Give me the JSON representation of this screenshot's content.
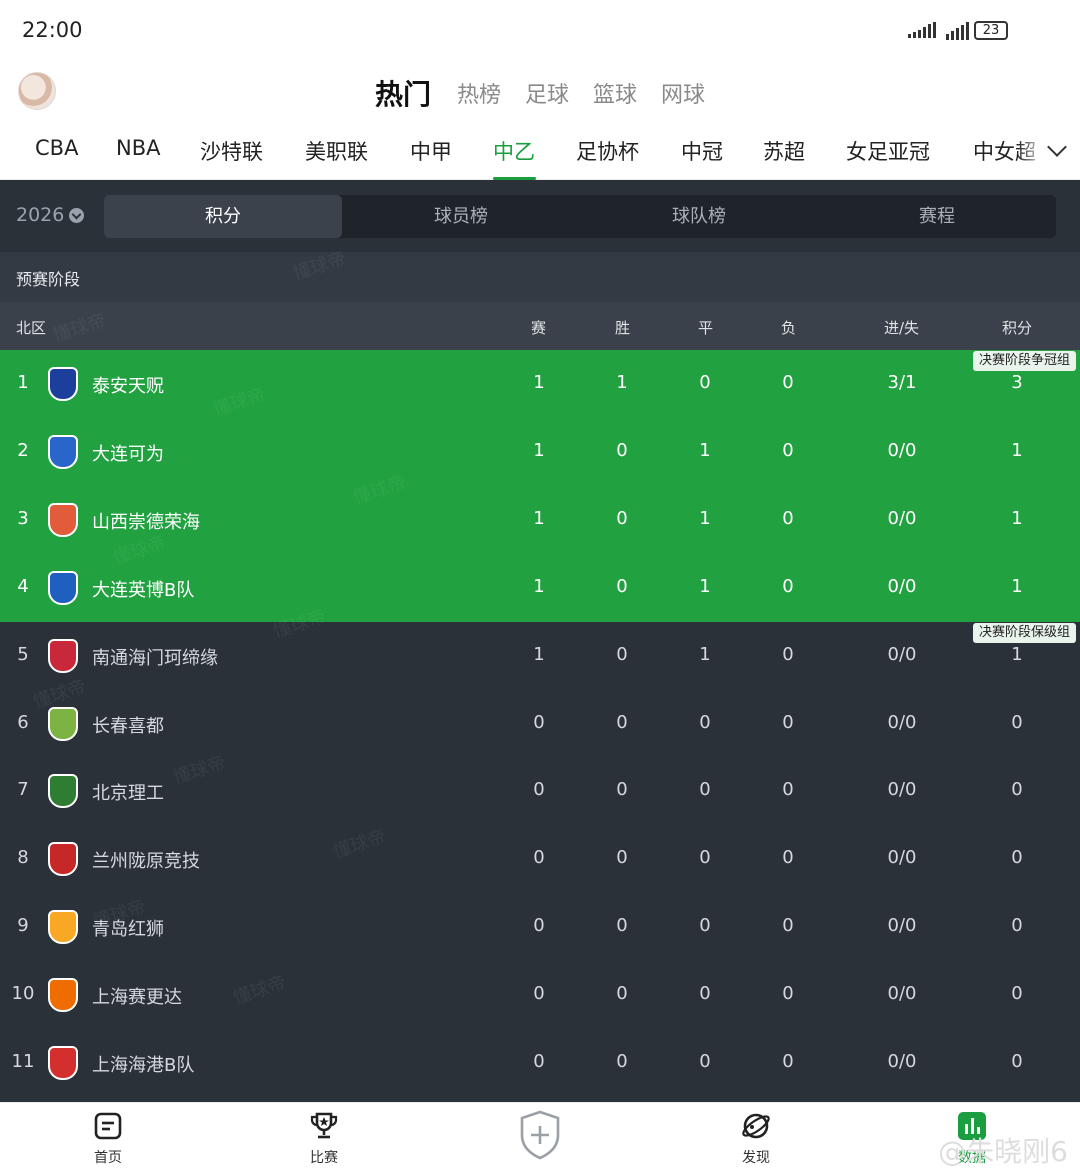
{
  "status_bar": {
    "time": "22:00",
    "battery": "23"
  },
  "header": {
    "tabs": [
      {
        "label": "热门",
        "active": true
      },
      {
        "label": "热榜"
      },
      {
        "label": "足球"
      },
      {
        "label": "篮球"
      },
      {
        "label": "网球"
      }
    ]
  },
  "leagues": [
    "CBA",
    "NBA",
    "沙特联",
    "美职联",
    "中甲",
    "中乙",
    "足协杯",
    "中冠",
    "苏超",
    "女足亚冠",
    "中女超"
  ],
  "leagues_active": "中乙",
  "season": "2026",
  "segments": [
    "积分",
    "球员榜",
    "球队榜",
    "赛程"
  ],
  "stage": "预赛阶段",
  "columns": {
    "group": "北区",
    "played": "赛",
    "won": "胜",
    "drawn": "平",
    "lost": "负",
    "goals": "进/失",
    "points": "积分"
  },
  "zones": {
    "title_group": "决赛阶段争冠组",
    "relegation_group": "决赛阶段保级组"
  },
  "table": [
    {
      "rank": "1",
      "team": "泰安天贶",
      "p": "1",
      "w": "1",
      "d": "0",
      "l": "0",
      "g": "3/1",
      "pts": "3",
      "zone": "title",
      "logo": "#1c3f9c"
    },
    {
      "rank": "2",
      "team": "大连可为",
      "p": "1",
      "w": "0",
      "d": "1",
      "l": "0",
      "g": "0/0",
      "pts": "1",
      "zone": "title",
      "logo": "#2a66c9"
    },
    {
      "rank": "3",
      "team": "山西崇德荣海",
      "p": "1",
      "w": "0",
      "d": "1",
      "l": "0",
      "g": "0/0",
      "pts": "1",
      "zone": "title",
      "logo": "#e25b3b"
    },
    {
      "rank": "4",
      "team": "大连英博B队",
      "p": "1",
      "w": "0",
      "d": "1",
      "l": "0",
      "g": "0/0",
      "pts": "1",
      "zone": "title",
      "logo": "#1f5fbf"
    },
    {
      "rank": "5",
      "team": "南通海门珂缔缘",
      "p": "1",
      "w": "0",
      "d": "1",
      "l": "0",
      "g": "0/0",
      "pts": "1",
      "zone": "relegation",
      "logo": "#c8283a"
    },
    {
      "rank": "6",
      "team": "长春喜都",
      "p": "0",
      "w": "0",
      "d": "0",
      "l": "0",
      "g": "0/0",
      "pts": "0",
      "zone": "relegation",
      "logo": "#7cb342"
    },
    {
      "rank": "7",
      "team": "北京理工",
      "p": "0",
      "w": "0",
      "d": "0",
      "l": "0",
      "g": "0/0",
      "pts": "0",
      "zone": "relegation",
      "logo": "#2e7d32"
    },
    {
      "rank": "8",
      "team": "兰州陇原竞技",
      "p": "0",
      "w": "0",
      "d": "0",
      "l": "0",
      "g": "0/0",
      "pts": "0",
      "zone": "relegation",
      "logo": "#c62828"
    },
    {
      "rank": "9",
      "team": "青岛红狮",
      "p": "0",
      "w": "0",
      "d": "0",
      "l": "0",
      "g": "0/0",
      "pts": "0",
      "zone": "relegation",
      "logo": "#f9a825"
    },
    {
      "rank": "10",
      "team": "上海赛更达",
      "p": "0",
      "w": "0",
      "d": "0",
      "l": "0",
      "g": "0/0",
      "pts": "0",
      "zone": "relegation",
      "logo": "#ef6c00"
    },
    {
      "rank": "11",
      "team": "上海海港B队",
      "p": "0",
      "w": "0",
      "d": "0",
      "l": "0",
      "g": "0/0",
      "pts": "0",
      "zone": "relegation",
      "logo": "#d32f2f"
    }
  ],
  "watermark": "懂球帝",
  "bottom_nav": [
    {
      "label": "首页",
      "icon": "home-list-icon"
    },
    {
      "label": "比赛",
      "icon": "trophy-icon"
    },
    {
      "label": "",
      "icon": "shield-plus-icon"
    },
    {
      "label": "发现",
      "icon": "planet-icon"
    },
    {
      "label": "数据",
      "icon": "chart-bars-icon",
      "active": true
    }
  ],
  "weibo_mark": "@朱晓刚6",
  "colors": {
    "accent": "#1a9e3f",
    "dark_bg": "#2b3139",
    "highlight": "#21a140"
  }
}
